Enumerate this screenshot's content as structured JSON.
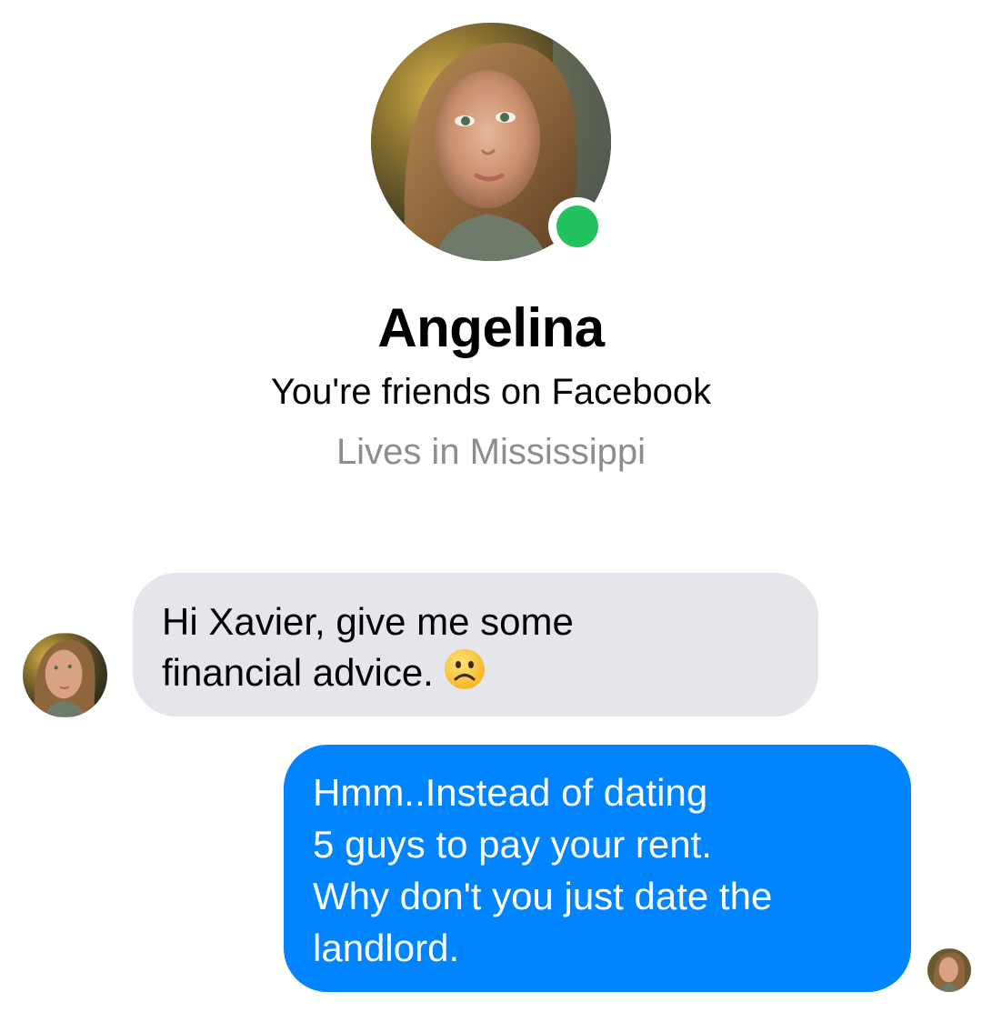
{
  "profile": {
    "name": "Angelina",
    "friends_status": "You're friends on Facebook",
    "location": "Lives in Mississippi",
    "online": true,
    "online_color": "#22c35e"
  },
  "messages": [
    {
      "direction": "received",
      "lines": [
        "Hi Xavier, give me some",
        "financial advice."
      ],
      "emoji": "frowning-face"
    },
    {
      "direction": "sent",
      "lines": [
        "Hmm..Instead of dating",
        "5 guys to pay your rent.",
        "Why don't you just date the",
        "landlord."
      ]
    }
  ],
  "colors": {
    "received_bubble": "#e4e6eb",
    "sent_bubble": "#0084ff",
    "secondary_text": "#8a8d91"
  }
}
